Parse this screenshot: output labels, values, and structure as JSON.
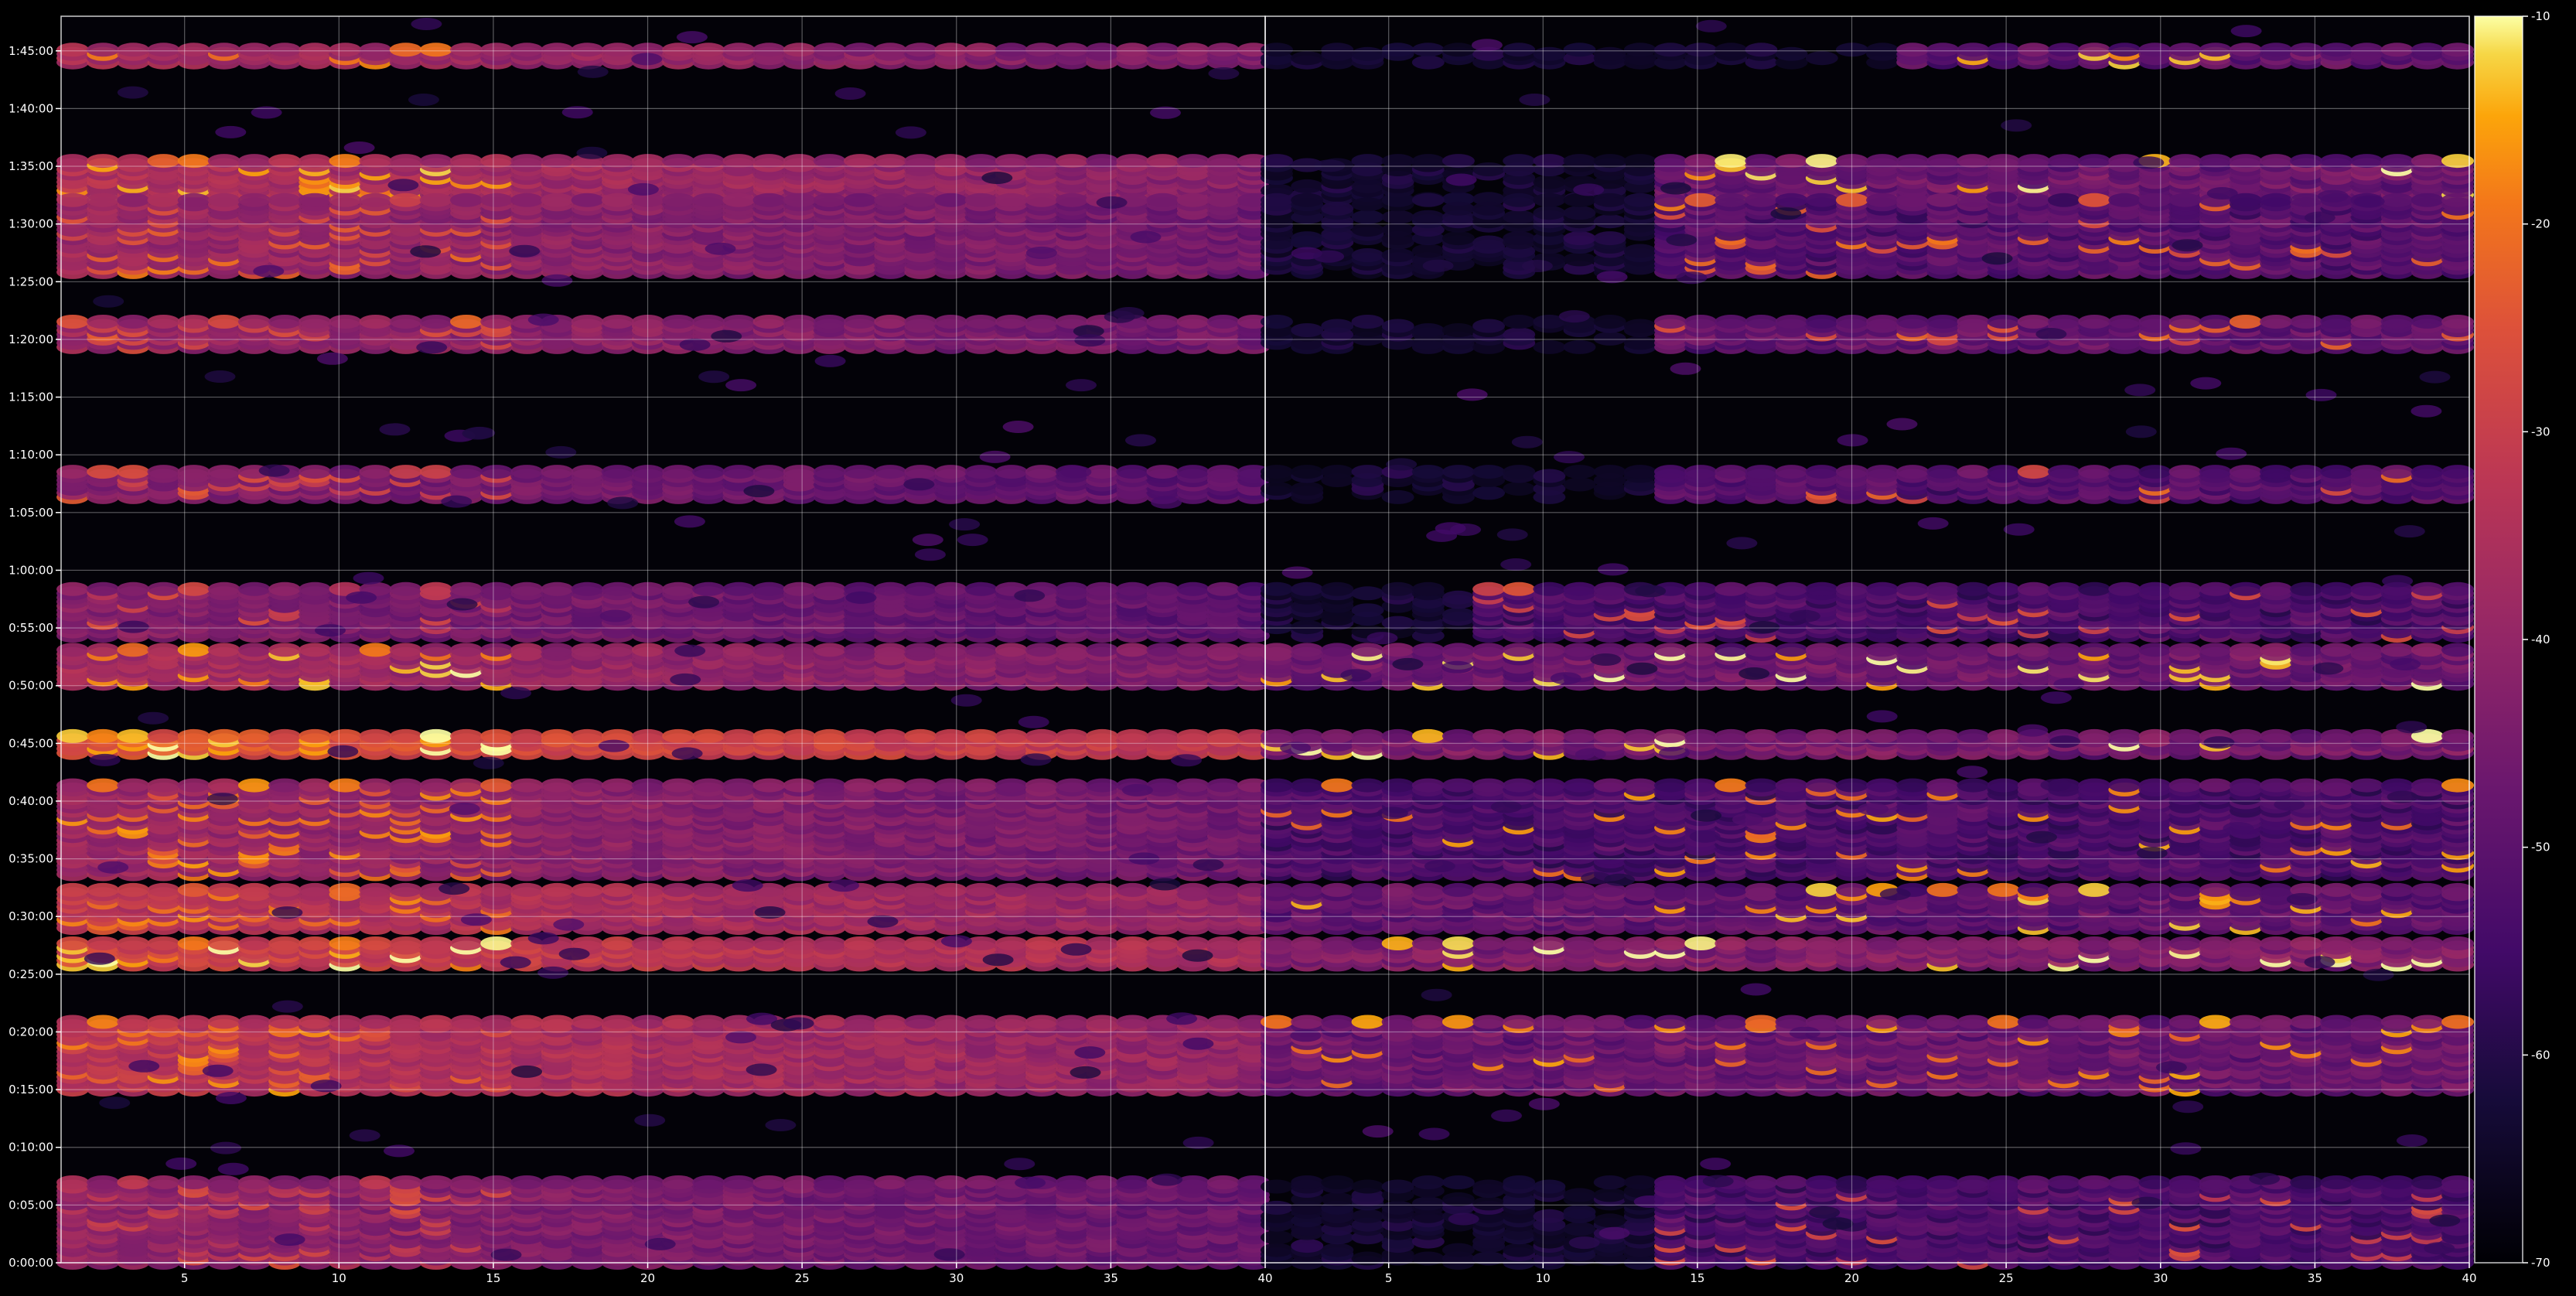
{
  "chart_data": {
    "type": "heatmap",
    "colormap": "inferno",
    "background": "#000000",
    "grid": true,
    "panels": [
      {
        "name": "",
        "xlim": [
          1,
          40
        ],
        "x_ticks": [
          "5",
          "10",
          "15",
          "20",
          "25",
          "30",
          "35",
          "40"
        ],
        "x_tick_values": [
          5,
          10,
          15,
          20,
          25,
          30,
          35,
          40
        ]
      },
      {
        "name": "",
        "xlim": [
          1,
          40
        ],
        "x_ticks": [
          "5",
          "10",
          "15",
          "20",
          "25",
          "30",
          "35",
          "40"
        ],
        "x_tick_values": [
          5,
          10,
          15,
          20,
          25,
          30,
          35,
          40
        ]
      }
    ],
    "y_axis": {
      "unit": "seconds",
      "ylim": [
        0,
        6480
      ],
      "tick_labels": [
        "0:00:00",
        "0:05:00",
        "0:10:00",
        "0:15:00",
        "0:20:00",
        "0:25:00",
        "0:30:00",
        "0:35:00",
        "0:40:00",
        "0:45:00",
        "0:50:00",
        "0:55:00",
        "1:00:00",
        "1:05:00",
        "1:10:00",
        "1:15:00",
        "1:20:00",
        "1:25:00",
        "1:30:00",
        "1:35:00",
        "1:40:00",
        "1:45:00"
      ],
      "tick_values": [
        0,
        300,
        600,
        900,
        1200,
        1500,
        1800,
        2100,
        2400,
        2700,
        3000,
        3300,
        3600,
        3900,
        4200,
        4500,
        4800,
        5100,
        5400,
        5700,
        6000,
        6300
      ]
    },
    "colorbar": {
      "range": [
        -70,
        -10
      ],
      "tick_labels": [
        "-10",
        "-20",
        "-30",
        "-40",
        "-50",
        "-60",
        "-70"
      ],
      "tick_values": [
        -10,
        -20,
        -30,
        -40,
        -50,
        -60,
        -70
      ]
    },
    "bands": [
      {
        "y_min": 6240,
        "y_max": 6320,
        "left_level": -36,
        "right_level": -46,
        "right_from": 22,
        "peak": -22
      },
      {
        "y_min": 5530,
        "y_max": 5740,
        "left_level": -34,
        "right_level": -44,
        "right_from": 14,
        "peak": -19
      },
      {
        "y_min": 5150,
        "y_max": 5540,
        "left_level": -38,
        "right_level": -48,
        "right_from": 14,
        "peak": -28
      },
      {
        "y_min": 4760,
        "y_max": 4900,
        "left_level": -38,
        "right_level": -46,
        "right_from": 14,
        "peak": -30
      },
      {
        "y_min": 3980,
        "y_max": 4130,
        "left_level": -42,
        "right_level": -48,
        "right_from": 14,
        "peak": -30
      },
      {
        "y_min": 3260,
        "y_max": 3520,
        "left_level": -42,
        "right_level": -50,
        "right_from": 8,
        "peak": -34
      },
      {
        "y_min": 3010,
        "y_max": 3200,
        "left_level": -36,
        "right_level": -44,
        "right_from": 1,
        "peak": -18
      },
      {
        "y_min": 2650,
        "y_max": 2750,
        "left_level": -24,
        "right_level": -42,
        "right_from": 1,
        "peak": -16
      },
      {
        "y_min": 2020,
        "y_max": 2500,
        "left_level": -38,
        "right_level": -50,
        "right_from": 1,
        "peak": -24
      },
      {
        "y_min": 1550,
        "y_max": 1680,
        "left_level": -28,
        "right_level": -40,
        "right_from": 1,
        "peak": -17
      },
      {
        "y_min": 1740,
        "y_max": 1950,
        "left_level": -32,
        "right_level": -46,
        "right_from": 1,
        "peak": -22
      },
      {
        "y_min": 900,
        "y_max": 1260,
        "left_level": -32,
        "right_level": -44,
        "right_from": 1,
        "peak": -24
      },
      {
        "y_min": 0,
        "y_max": 420,
        "left_level": -40,
        "right_level": -50,
        "right_from": 14,
        "peak": -34
      }
    ]
  }
}
